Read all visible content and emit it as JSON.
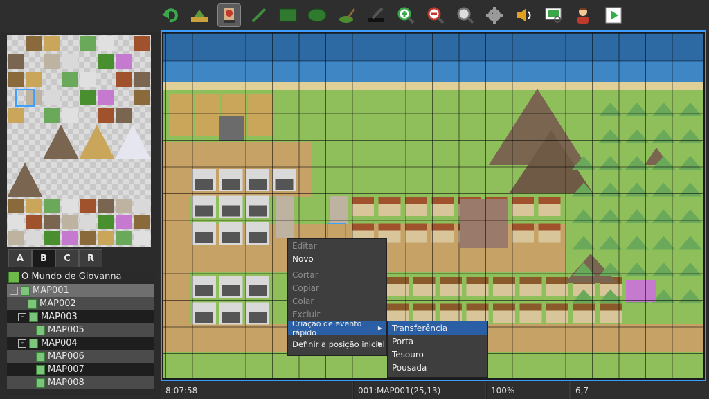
{
  "toolbar": {
    "buttons": [
      {
        "name": "undo-icon",
        "color": "#3aa84a"
      },
      {
        "name": "map-layer-icon",
        "color": "#c9a23c"
      },
      {
        "name": "event-layer-icon",
        "color": "#c0392b",
        "selected": true
      },
      {
        "name": "pencil-icon",
        "color": "#3f8f3f"
      },
      {
        "name": "rectangle-icon",
        "color": "#2f7a2f"
      },
      {
        "name": "ellipse-icon",
        "color": "#2f7a2f"
      },
      {
        "name": "fill-icon",
        "color": "#4a8f2f"
      },
      {
        "name": "shadow-pen-icon",
        "color": "#444444"
      },
      {
        "name": "zoom-in-icon",
        "color": "#3aa84a"
      },
      {
        "name": "zoom-out-icon",
        "color": "#c0392b"
      },
      {
        "name": "zoom-actual-icon",
        "color": "#777777"
      },
      {
        "name": "gear-icon",
        "color": "#9a9a9a"
      },
      {
        "name": "sound-icon",
        "color": "#e0a020"
      },
      {
        "name": "resource-search-icon",
        "color": "#3aa84a"
      },
      {
        "name": "character-generator-icon",
        "color": "#c0392b"
      },
      {
        "name": "playtest-icon",
        "color": "#2fb04a"
      }
    ]
  },
  "tileset_tabs": [
    "A",
    "B",
    "C",
    "R"
  ],
  "active_tab": "B",
  "map_tree": {
    "project": "O Mundo de Giovanna",
    "items": [
      {
        "label": "MAP001",
        "level": 0,
        "expanded": true,
        "selected": true
      },
      {
        "label": "MAP002",
        "level": 1
      },
      {
        "label": "MAP003",
        "level": 1,
        "expanded": true
      },
      {
        "label": "MAP005",
        "level": 2
      },
      {
        "label": "MAP004",
        "level": 1,
        "expanded": true
      },
      {
        "label": "MAP006",
        "level": 2
      },
      {
        "label": "MAP007",
        "level": 2
      },
      {
        "label": "MAP008",
        "level": 2
      }
    ]
  },
  "context_menu": {
    "items": [
      {
        "label": "Editar",
        "disabled": true
      },
      {
        "label": "Novo",
        "disabled": false
      },
      {
        "label": "Cortar",
        "disabled": true
      },
      {
        "label": "Copiar",
        "disabled": true
      },
      {
        "label": "Colar",
        "disabled": true
      },
      {
        "label": "Excluir",
        "disabled": true
      },
      {
        "label": "Criação de evento rápido",
        "disabled": false,
        "has_submenu": true
      },
      {
        "label": "Definir a posição inicial",
        "disabled": false,
        "has_submenu": true
      }
    ],
    "submenu": [
      "Transferência",
      "Porta",
      "Tesouro",
      "Pousada"
    ]
  },
  "status_bar": {
    "time": "8:07:58",
    "map_position": "001:MAP001(25,13)",
    "zoom": "100%",
    "coordinates": "6,7"
  },
  "colors": {
    "accent": "#3d9dff",
    "menu_highlight": "#2a5fa6",
    "water": "#2d6aa3",
    "grass": "#8fbf5a",
    "dirt": "#c7a267"
  }
}
